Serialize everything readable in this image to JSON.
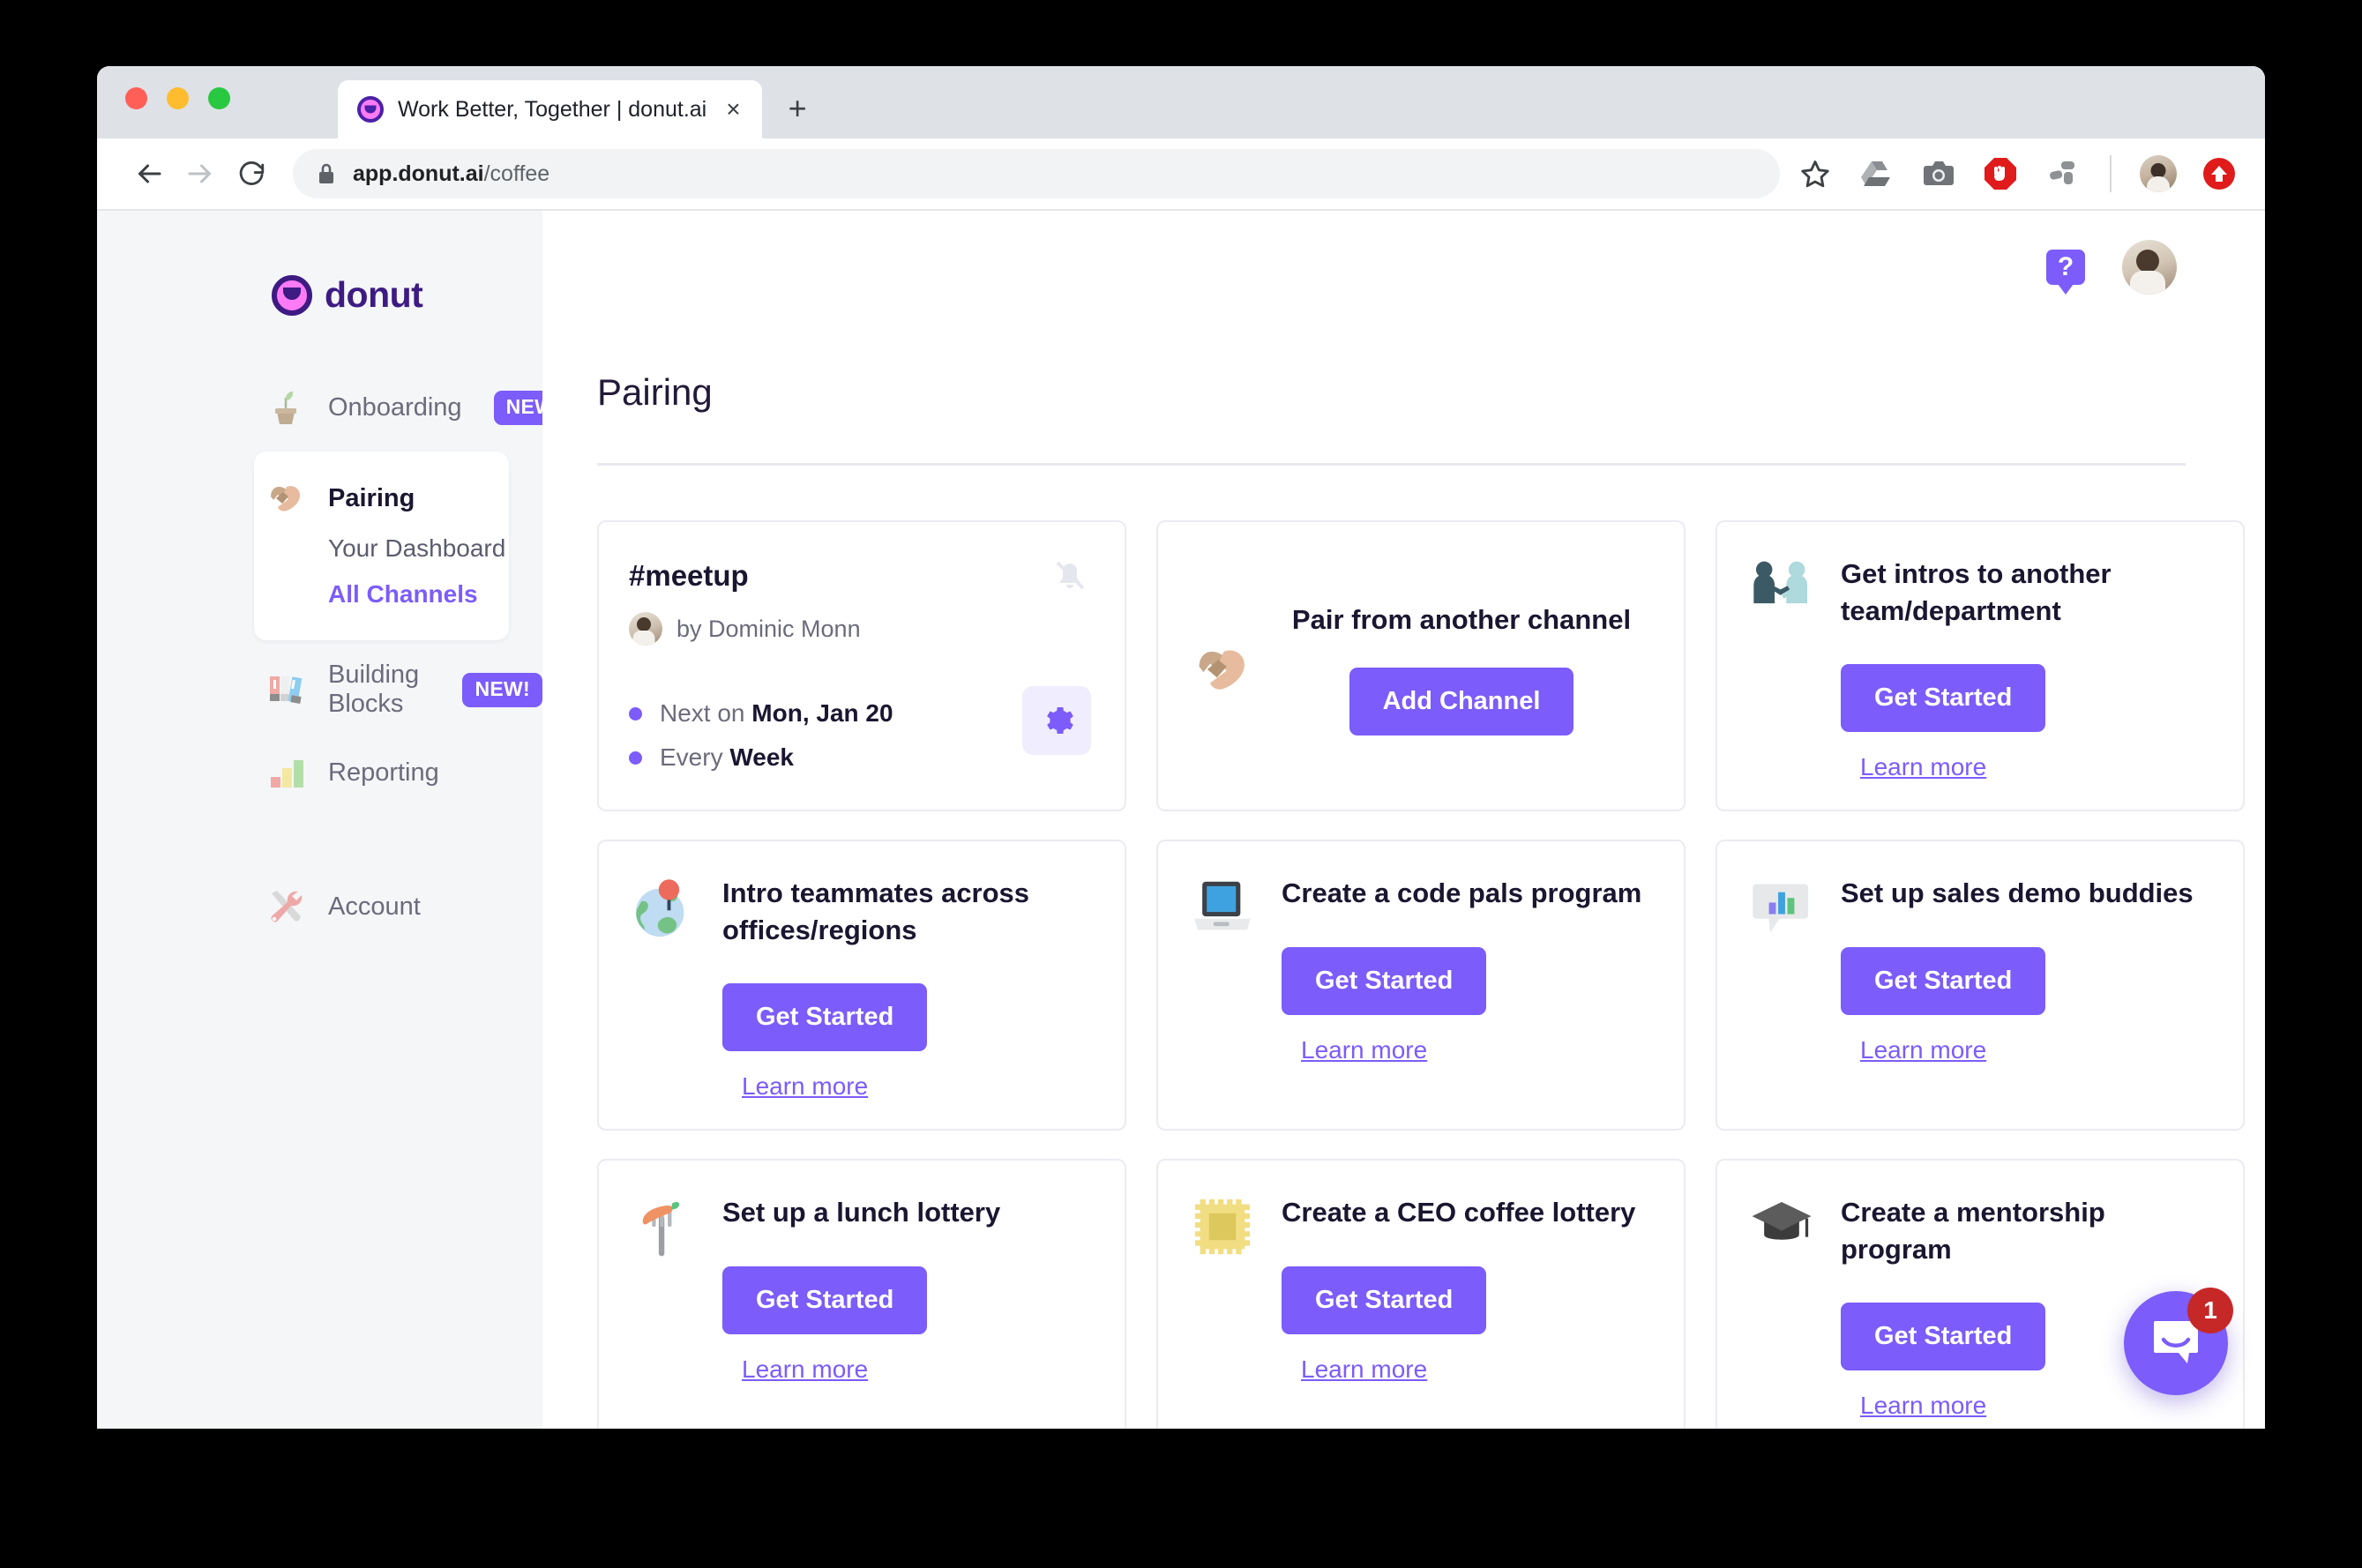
{
  "browser": {
    "tab_title": "Work Better, Together | donut.ai",
    "tab_close_label": "×",
    "new_tab_label": "+",
    "url_host": "app.donut.ai",
    "url_path": "/coffee",
    "icons": {
      "back": "back-arrow-icon",
      "forward": "forward-arrow-icon",
      "reload": "reload-icon",
      "lock": "lock-icon",
      "bookmark": "star-icon",
      "drive": "google-drive-icon",
      "screenshot": "camera-icon",
      "adblock": "adblock-stop-hand-icon",
      "extension": "extension-icon",
      "profile": "profile-avatar-icon",
      "upload": "upload-arrow-icon"
    }
  },
  "sidebar": {
    "logo_text": "donut",
    "items": [
      {
        "label": "Onboarding",
        "icon": "seedling-icon",
        "badge": "NEW!"
      },
      {
        "label": "Pairing",
        "icon": "handshake-icon",
        "badge": ""
      },
      {
        "label": "Building Blocks",
        "icon": "building-blocks-icon",
        "badge": "NEW!"
      },
      {
        "label": "Reporting",
        "icon": "bar-chart-icon",
        "badge": ""
      },
      {
        "label": "Account",
        "icon": "tools-icon",
        "badge": ""
      }
    ],
    "pairing_sub_items": [
      {
        "label": "Your Dashboard",
        "style": "plain"
      },
      {
        "label": "All Channels",
        "style": "link"
      }
    ]
  },
  "header": {
    "help_label": "?",
    "avatar": "user-avatar"
  },
  "page": {
    "title": "Pairing"
  },
  "meetup_card": {
    "channel": "#meetup",
    "by_prefix": "by ",
    "author": "Dominic Monn",
    "facts": [
      {
        "prefix": "Next on ",
        "value": "Mon, Jan 20"
      },
      {
        "prefix": "Every ",
        "value": "Week"
      }
    ],
    "bell_icon": "bell-muted-icon",
    "gear_icon": "gear-icon"
  },
  "pair_card": {
    "title": "Pair from another channel",
    "button": "Add Channel",
    "icon": "handshake-icon"
  },
  "cards": [
    {
      "title": "Get intros to another team/department",
      "button": "Get Started",
      "link": "Learn more",
      "icon": "people-shaking-hands-icon"
    },
    {
      "title": "Intro teammates across offices/regions",
      "button": "Get Started",
      "link": "Learn more",
      "icon": "globe-pin-icon"
    },
    {
      "title": "Create a code pals program",
      "button": "Get Started",
      "link": "Learn more",
      "icon": "laptop-icon"
    },
    {
      "title": "Set up sales demo buddies",
      "button": "Get Started",
      "link": "Learn more",
      "icon": "chart-bubble-icon"
    },
    {
      "title": "Set up a lunch lottery",
      "button": "Get Started",
      "link": "Learn more",
      "icon": "fork-food-icon"
    },
    {
      "title": "Create a CEO coffee lottery",
      "button": "Get Started",
      "link": "Learn more",
      "icon": "ticket-icon"
    },
    {
      "title": "Create a mentorship program",
      "button": "Get Started",
      "link": "Learn more",
      "icon": "graduation-cap-icon"
    }
  ],
  "intercom": {
    "badge_count": "1",
    "icon": "chat-bubble-icon"
  },
  "colors": {
    "accent": "#7c5cfa",
    "sidebar_bg": "#f4f6f8",
    "text_dark": "#1b1630",
    "text_muted": "#6b6b7b",
    "card_border": "#eceaf2",
    "badge_red": "#c62828"
  }
}
